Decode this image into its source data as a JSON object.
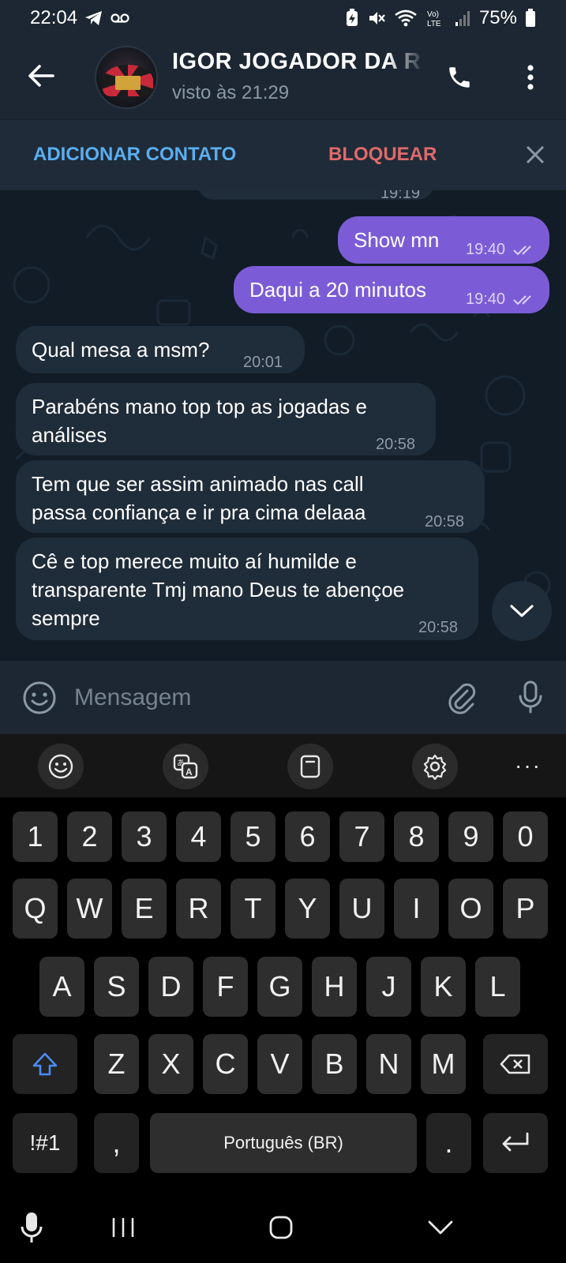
{
  "status_bar": {
    "time": "22:04",
    "battery": "75%",
    "icons": [
      "telegram-icon",
      "voicemail-icon",
      "battery-saver-icon",
      "mute-icon",
      "wifi-icon",
      "volte-icon",
      "signal-icon",
      "battery-icon"
    ]
  },
  "header": {
    "contact_name": "IGOR JOGADOR DA R",
    "last_seen": "visto às 21:29"
  },
  "action_bar": {
    "add_contact": "ADICIONAR CONTATO",
    "block": "BLOQUEAR"
  },
  "messages": [
    {
      "id": "partial",
      "direction": "in",
      "text": "",
      "time": "19:19"
    },
    {
      "id": "m1",
      "direction": "out",
      "text": "Show mn",
      "time": "19:40",
      "read": true
    },
    {
      "id": "m2",
      "direction": "out",
      "text": "Daqui a 20 minutos",
      "time": "19:40",
      "read": true
    },
    {
      "id": "m3",
      "direction": "in",
      "text": "Qual mesa a msm?",
      "time": "20:01"
    },
    {
      "id": "m4",
      "direction": "in",
      "line1": "Parabéns mano top top as jogadas e",
      "line2": "análises",
      "time": "20:58"
    },
    {
      "id": "m5",
      "direction": "in",
      "line1": "Tem que ser assim animado nas call",
      "line2": "passa confiança e ir pra cima delaaa",
      "time": "20:58"
    },
    {
      "id": "m6",
      "direction": "in",
      "line1": "Cê e top merece muito aí humilde e",
      "line2": "transparente Tmj mano Deus te abençoe",
      "line3": "sempre",
      "time": "20:58"
    }
  ],
  "input": {
    "placeholder": "Mensagem"
  },
  "keyboard": {
    "row_numbers": [
      "1",
      "2",
      "3",
      "4",
      "5",
      "6",
      "7",
      "8",
      "9",
      "0"
    ],
    "row1": [
      "Q",
      "W",
      "E",
      "R",
      "T",
      "Y",
      "U",
      "I",
      "O",
      "P"
    ],
    "row2": [
      "A",
      "S",
      "D",
      "F",
      "G",
      "H",
      "J",
      "K",
      "L"
    ],
    "row3": [
      "Z",
      "X",
      "C",
      "V",
      "B",
      "N",
      "M"
    ],
    "symbols": "!#1",
    "comma": ",",
    "space": "Português (BR)",
    "period": ".",
    "more": "···"
  },
  "colors": {
    "outgoing_bubble": "#7b5cd6",
    "incoming_bubble": "#1f2c39",
    "add_contact": "#5aaef0",
    "block": "#e06a6a",
    "header_bg": "#1c2733"
  }
}
